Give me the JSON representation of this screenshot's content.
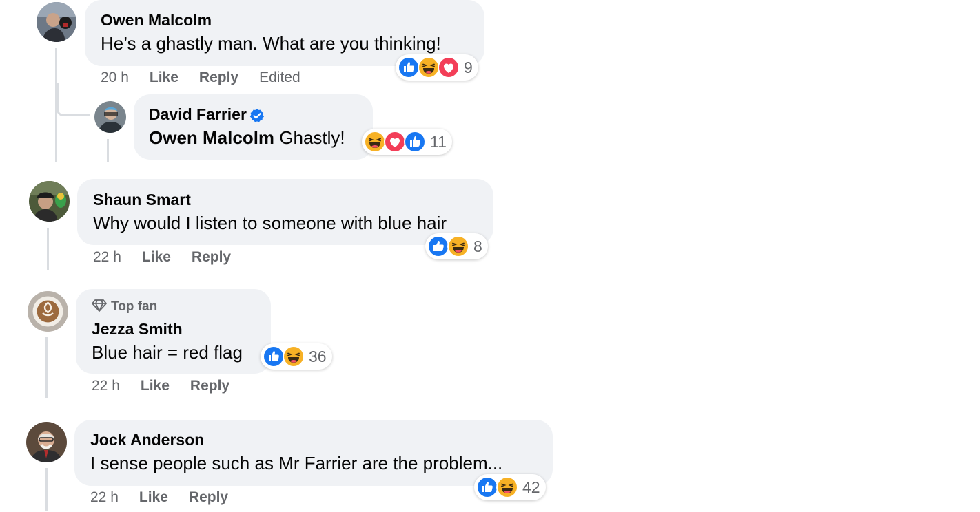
{
  "comments": [
    {
      "author": "Owen Malcolm",
      "text": "He’s a ghastly man. What are you thinking!",
      "time": "20 h",
      "like": "Like",
      "reply": "Reply",
      "edited": "Edited",
      "reactions": [
        "like",
        "haha",
        "love"
      ],
      "reaction_count": "9"
    },
    {
      "author": "David Farrier",
      "verified": true,
      "mention": "Owen Malcolm",
      "text": "Ghastly!",
      "reactions": [
        "haha",
        "love",
        "like"
      ],
      "reaction_count": "11"
    },
    {
      "author": "Shaun Smart",
      "text": "Why would I listen to someone with blue hair",
      "time": "22 h",
      "like": "Like",
      "reply": "Reply",
      "reactions": [
        "like",
        "haha"
      ],
      "reaction_count": "8"
    },
    {
      "badge": "Top fan",
      "author": "Jezza Smith",
      "text": "Blue hair = red flag",
      "time": "22 h",
      "like": "Like",
      "reply": "Reply",
      "reactions": [
        "like",
        "haha"
      ],
      "reaction_count": "36"
    },
    {
      "author": "Jock Anderson",
      "text": "I sense people such as Mr Farrier are the problem...",
      "time": "22 h",
      "like": "Like",
      "reply": "Reply",
      "reactions": [
        "like",
        "haha"
      ],
      "reaction_count": "42"
    }
  ],
  "colors": {
    "bubble": "#f0f2f5",
    "meta_text": "#65676b",
    "like_blue": "#1877f2",
    "love_red": "#f33e58",
    "haha_yellow": "#f7b125"
  }
}
